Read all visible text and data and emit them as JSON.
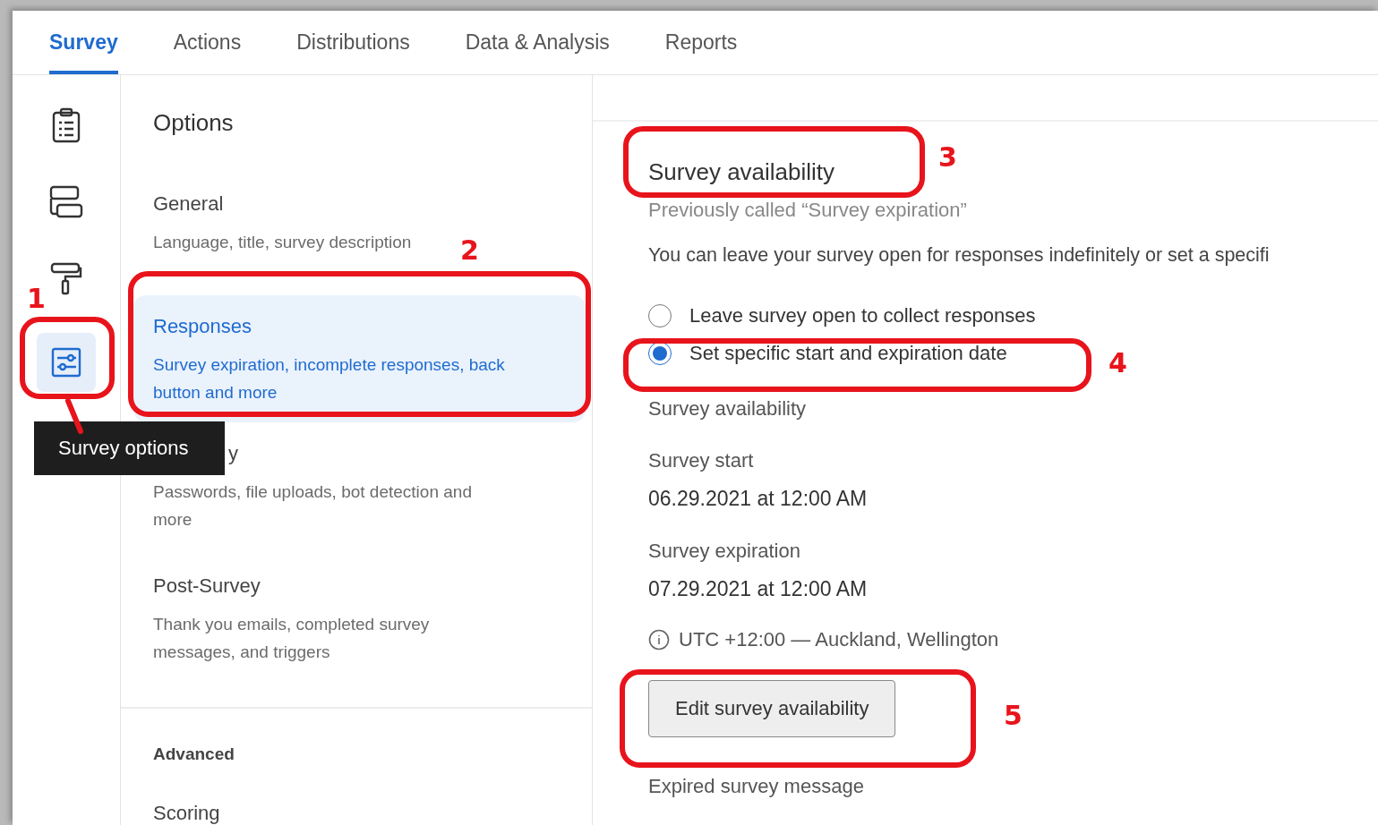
{
  "tabs": [
    {
      "label": "Survey",
      "selected": true
    },
    {
      "label": "Actions",
      "selected": false
    },
    {
      "label": "Distributions",
      "selected": false
    },
    {
      "label": "Data & Analysis",
      "selected": false
    },
    {
      "label": "Reports",
      "selected": false
    }
  ],
  "sidebar": {
    "icons": [
      {
        "kind": "clipboard",
        "selected": false
      },
      {
        "kind": "blocks",
        "selected": false
      },
      {
        "kind": "roller",
        "selected": false
      },
      {
        "kind": "sliders",
        "selected": true
      }
    ],
    "tooltip": "Survey options"
  },
  "options": {
    "title": "Options",
    "items": [
      {
        "title": "General",
        "description": "Language, title, survey description",
        "selected": false,
        "covered": false
      },
      {
        "title": "Responses",
        "description": "Survey expiration, incomplete responses, back button and more",
        "selected": true,
        "covered": false
      },
      {
        "title": "y",
        "description": "Passwords, file uploads, bot detection and more",
        "selected": false,
        "covered": true
      },
      {
        "title": "Post-Survey",
        "description": "Thank you emails, completed survey messages, and triggers",
        "selected": false,
        "covered": false
      }
    ],
    "section_heading": "Advanced",
    "section_items": [
      "Scoring"
    ]
  },
  "content": {
    "heading": "Survey availability",
    "subtitle": "Previously called “Survey expiration”",
    "intro": "You can leave your survey open for responses indefinitely or set a specifi",
    "choices": [
      {
        "label": "Leave survey open to collect responses",
        "selected": false
      },
      {
        "label": "Set specific start and expiration date",
        "selected": true
      }
    ],
    "availability_label": "Survey availability",
    "start_label": "Survey start",
    "start_value": "06.29.2021 at 12:00 AM",
    "expiration_label": "Survey expiration",
    "expiration_value": "07.29.2021 at 12:00 AM",
    "timezone": "UTC +12:00 — Auckland, Wellington",
    "button": "Edit survey availability",
    "next_label": "Expired survey message"
  },
  "annotations": [
    "1",
    "2",
    "3",
    "4",
    "5"
  ]
}
